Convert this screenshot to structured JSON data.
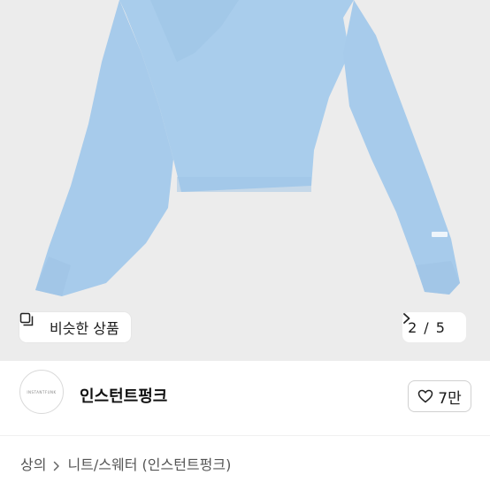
{
  "product_image": {
    "alt": "light blue knit sweater",
    "sweater_color": "#a8cdec",
    "background_color": "#ececec"
  },
  "similar_button": {
    "label": "비슷한 상품",
    "icon": "similar-items-icon"
  },
  "pager": {
    "current": "2",
    "separator": "/",
    "total": "5",
    "icon": "chevron-right-icon"
  },
  "seller": {
    "avatar_text": "INSTANTFUNK",
    "name": "인스턴트펑크"
  },
  "like": {
    "icon": "heart-icon",
    "count": "7만"
  },
  "breadcrumb": {
    "items": [
      "상의",
      "니트/스웨터 (인스턴트펑크)"
    ],
    "icon": "chevron-right-icon"
  }
}
